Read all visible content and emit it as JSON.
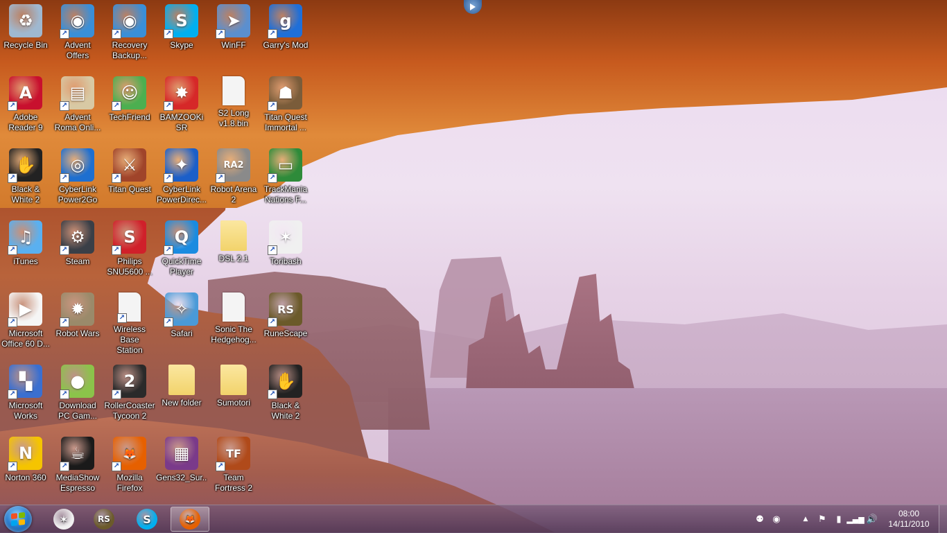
{
  "desktop": {
    "icons": [
      {
        "label": "Recycle Bin",
        "icon": "recycle-bin-icon",
        "color": "#9fb8d0",
        "glyph": "♻",
        "shortcut": false
      },
      {
        "label": "Advent\nOffers",
        "icon": "disc-icon",
        "color": "#3a8fd8",
        "glyph": "◉",
        "shortcut": true
      },
      {
        "label": "Recovery\nBackup...",
        "icon": "disc-icon",
        "color": "#3a8fd8",
        "glyph": "◉",
        "shortcut": true
      },
      {
        "label": "Skype",
        "icon": "skype-icon",
        "color": "#00aff0",
        "glyph": "S",
        "shortcut": true
      },
      {
        "label": "WinFF",
        "icon": "winff-icon",
        "color": "#5b8fcf",
        "glyph": "➤",
        "shortcut": true
      },
      {
        "label": "Garry's Mod",
        "icon": "garrys-mod-icon",
        "color": "#1f6fd8",
        "glyph": "g",
        "shortcut": true
      },
      {
        "label": "Adobe\nReader 9",
        "icon": "adobe-reader-icon",
        "color": "#c8102e",
        "glyph": "A",
        "shortcut": true
      },
      {
        "label": "Advent\nRoma Onli...",
        "icon": "book-icon",
        "color": "#d8c9a4",
        "glyph": "▤",
        "shortcut": true
      },
      {
        "label": "TechFriend",
        "icon": "techfriend-icon",
        "color": "#4caf50",
        "glyph": "☺",
        "shortcut": true
      },
      {
        "label": "BAMZOOKi\nSR",
        "icon": "bamzooki-icon",
        "color": "#d62828",
        "glyph": "✸",
        "shortcut": true
      },
      {
        "label": "S2 Long\nv1.8.bin",
        "icon": "file-icon",
        "color": "#f4f4f4",
        "glyph": "",
        "shortcut": false
      },
      {
        "label": "Titan Quest\nImmortal ...",
        "icon": "titan-quest-immortal-icon",
        "color": "#7a5c3a",
        "glyph": "☗",
        "shortcut": true
      },
      {
        "label": "Black &\nWhite 2",
        "icon": "black-white-icon",
        "color": "#222222",
        "glyph": "✋",
        "shortcut": true
      },
      {
        "label": "CyberLink\nPower2Go",
        "icon": "cyberlink-power2go-icon",
        "color": "#1e6fd0",
        "glyph": "◎",
        "shortcut": true
      },
      {
        "label": "Titan Quest",
        "icon": "titan-quest-icon",
        "color": "#a0442a",
        "glyph": "⚔",
        "shortcut": true
      },
      {
        "label": "CyberLink\nPowerDirec...",
        "icon": "cyberlink-powerdirector-icon",
        "color": "#1b5fc9",
        "glyph": "✦",
        "shortcut": true
      },
      {
        "label": "Robot Arena\n2",
        "icon": "robot-arena-icon",
        "color": "#8a8a8a",
        "glyph": "RA2",
        "shortcut": true
      },
      {
        "label": "TrackMania\nNations F...",
        "icon": "trackmania-icon",
        "color": "#2e8b3a",
        "glyph": "▭",
        "shortcut": true
      },
      {
        "label": "iTunes",
        "icon": "itunes-icon",
        "color": "#5ab0f0",
        "glyph": "♫",
        "shortcut": true
      },
      {
        "label": "Steam",
        "icon": "steam-icon",
        "color": "#3a3f47",
        "glyph": "⚙",
        "shortcut": true
      },
      {
        "label": "Philips\nSNU5600 ...",
        "icon": "philips-icon",
        "color": "#d0202a",
        "glyph": "S",
        "shortcut": true
      },
      {
        "label": "QuickTime\nPlayer",
        "icon": "quicktime-icon",
        "color": "#1a8be0",
        "glyph": "Q",
        "shortcut": true
      },
      {
        "label": "DSL 2.1",
        "icon": "folder-icon",
        "color": "#f2d36b",
        "glyph": "",
        "shortcut": false
      },
      {
        "label": "Toribash",
        "icon": "toribash-icon",
        "color": "#f0f0f0",
        "glyph": "✶",
        "shortcut": true
      },
      {
        "label": "Microsoft\nOffice 60 D...",
        "icon": "microsoft-office-icon",
        "color": "#f5f5f5",
        "glyph": "▶",
        "shortcut": true
      },
      {
        "label": "Robot Wars",
        "icon": "robot-wars-icon",
        "color": "#9a8a6a",
        "glyph": "✹",
        "shortcut": true
      },
      {
        "label": "Wireless Base\nStation",
        "icon": "file-icon",
        "color": "#f4f4f4",
        "glyph": "",
        "shortcut": true
      },
      {
        "label": "Safari",
        "icon": "safari-icon",
        "color": "#4a9ad8",
        "glyph": "✧",
        "shortcut": true
      },
      {
        "label": "Sonic The\nHedgehog...",
        "icon": "file-icon",
        "color": "#f4f4f4",
        "glyph": "",
        "shortcut": false
      },
      {
        "label": "RuneScape",
        "icon": "runescape-icon",
        "color": "#6b5a2a",
        "glyph": "RS",
        "shortcut": true
      },
      {
        "label": "Microsoft\nWorks",
        "icon": "microsoft-works-icon",
        "color": "#3a6fd0",
        "glyph": "▚",
        "shortcut": true
      },
      {
        "label": "Download\nPC Gam...",
        "icon": "download-games-icon",
        "color": "#8bc34a",
        "glyph": "●",
        "shortcut": true
      },
      {
        "label": "RollerCoaster\nTycoon 2",
        "icon": "rollercoaster-tycoon-icon",
        "color": "#2a2a2a",
        "glyph": "2",
        "shortcut": true
      },
      {
        "label": "New folder",
        "icon": "folder-icon",
        "color": "#f2d36b",
        "glyph": "",
        "shortcut": false
      },
      {
        "label": "Sumotori",
        "icon": "folder-icon",
        "color": "#f2d36b",
        "glyph": "",
        "shortcut": false
      },
      {
        "label": "Black &\nWhite 2",
        "icon": "black-white-icon",
        "color": "#222222",
        "glyph": "✋",
        "shortcut": true
      },
      {
        "label": "Norton 360",
        "icon": "norton-icon",
        "color": "#f5c400",
        "glyph": "N",
        "shortcut": true
      },
      {
        "label": "MediaShow\nEspresso",
        "icon": "mediashow-icon",
        "color": "#1a1a1a",
        "glyph": "☕",
        "shortcut": true
      },
      {
        "label": "Mozilla\nFirefox",
        "icon": "firefox-icon",
        "color": "#e66000",
        "glyph": "🦊",
        "shortcut": true
      },
      {
        "label": "Gens32_Sur...",
        "icon": "winrar-icon",
        "color": "#7a3a8a",
        "glyph": "▦",
        "shortcut": false
      },
      {
        "label": "Team\nFortress 2",
        "icon": "team-fortress-icon",
        "color": "#b04a1a",
        "glyph": "TF",
        "shortcut": true
      }
    ]
  },
  "taskbar": {
    "pinned": [
      {
        "name": "toribash",
        "icon": "toribash-icon",
        "color": "#f0f0f0",
        "glyph": "✶"
      },
      {
        "name": "runescape",
        "icon": "runescape-icon",
        "color": "#6b5a2a",
        "glyph": "RS"
      },
      {
        "name": "skype",
        "icon": "skype-icon",
        "color": "#00aff0",
        "glyph": "S"
      },
      {
        "name": "firefox",
        "icon": "firefox-icon",
        "color": "#e66000",
        "glyph": "🦊"
      }
    ],
    "clock": {
      "time": "08:00",
      "date": "14/11/2010"
    }
  }
}
